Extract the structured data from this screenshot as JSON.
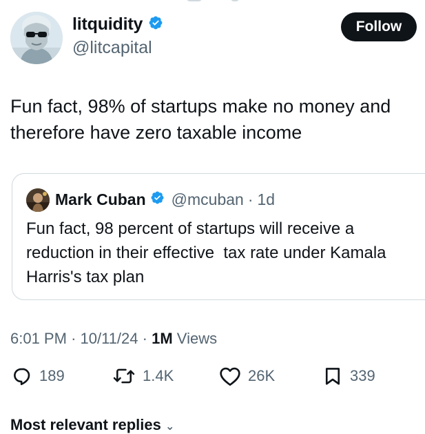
{
  "author": {
    "display_name": "litquidity",
    "handle": "@litcapital",
    "follow_label": "Follow"
  },
  "tweet": {
    "text_line1": "Fun fact, 98% of startups make no money and",
    "text_line2": "therefore have zero taxable income"
  },
  "quote": {
    "display_name": "Mark Cuban",
    "handle": "@mcuban",
    "separator": "·",
    "age": "1d",
    "text_line1": "Fun fact, 98 percent of startups will receive a",
    "text_line2": "reduction in their effective  tax rate under Kamala",
    "text_line3": "Harris's tax plan"
  },
  "meta": {
    "time": "6:01 PM",
    "date": "10/11/24",
    "separator": "·",
    "views_count": "1M",
    "views_label": "Views"
  },
  "actions": {
    "replies": "189",
    "reposts": "1.4K",
    "likes": "26K",
    "bookmarks": "339"
  },
  "replies_sort_label": "Most relevant replies",
  "colors": {
    "text_primary": "#0f1419",
    "text_secondary": "#536471",
    "verified_blue": "#1d9bf0",
    "border": "#cfd9de",
    "follow_bg": "#0f1419"
  },
  "icons": {
    "verified": "verified-badge-icon",
    "reply": "reply-bubble-icon",
    "repost": "repost-arrows-icon",
    "like": "heart-icon",
    "bookmark": "bookmark-icon",
    "chevron": "chevron-down-icon"
  }
}
